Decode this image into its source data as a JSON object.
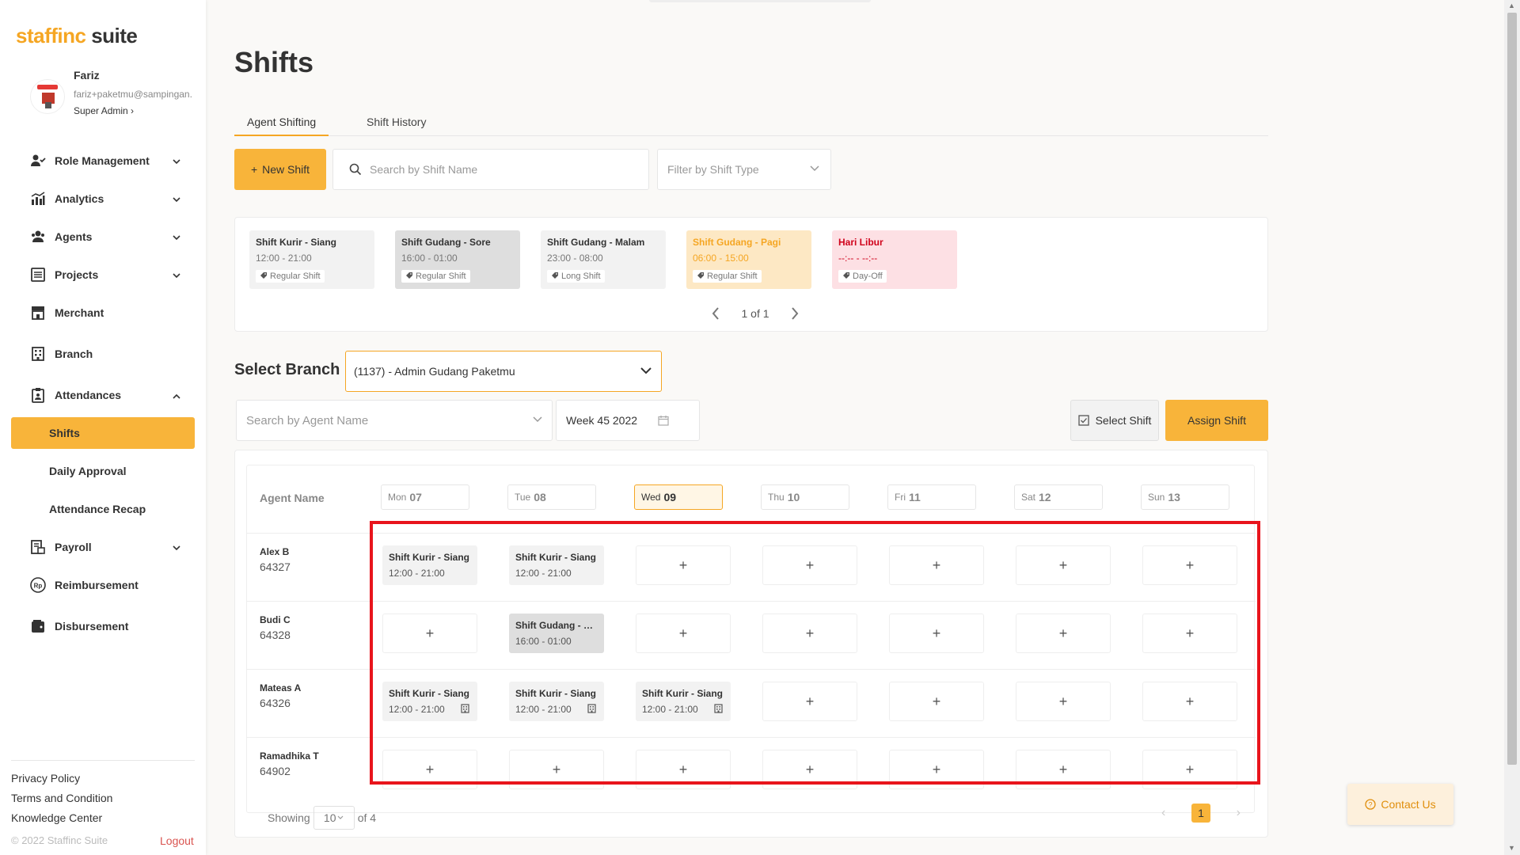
{
  "brand": {
    "name_part1": "staffinc",
    "name_part2": "suite",
    "accent": "#f8b43a",
    "highlight": "#e8141c"
  },
  "profile": {
    "name": "Fariz",
    "email": "fariz+paketmu@sampingan.",
    "role": "Super Admin",
    "avatar_text": "Paketmu"
  },
  "sidebar": {
    "items": [
      {
        "label": "Role Management",
        "icon": "role-icon",
        "expandable": true
      },
      {
        "label": "Analytics",
        "icon": "analytics-icon",
        "expandable": true
      },
      {
        "label": "Agents",
        "icon": "agents-icon",
        "expandable": true
      },
      {
        "label": "Projects",
        "icon": "projects-icon",
        "expandable": true
      },
      {
        "label": "Merchant",
        "icon": "merchant-icon",
        "expandable": false
      },
      {
        "label": "Branch",
        "icon": "branch-icon",
        "expandable": false
      },
      {
        "label": "Attendances",
        "icon": "attendance-icon",
        "expandable": true,
        "expanded": true
      },
      {
        "label": "Payroll",
        "icon": "payroll-icon",
        "expandable": true
      },
      {
        "label": "Reimbursement",
        "icon": "reimbursement-icon",
        "expandable": false
      },
      {
        "label": "Disbursement",
        "icon": "disbursement-icon",
        "expandable": false
      }
    ],
    "sub_items": [
      {
        "label": "Shifts",
        "active": true
      },
      {
        "label": "Daily Approval",
        "active": false
      },
      {
        "label": "Attendance Recap",
        "active": false
      }
    ],
    "footer_links": [
      "Privacy Policy",
      "Terms and Condition",
      "Knowledge Center"
    ],
    "copyright": "© 2022 Staffinc Suite",
    "logout": "Logout"
  },
  "page": {
    "title": "Shifts"
  },
  "tabs": [
    {
      "label": "Agent Shifting",
      "active": true
    },
    {
      "label": "Shift History",
      "active": false
    }
  ],
  "toolbar": {
    "new_shift": "New Shift",
    "search_placeholder": "Search by Shift Name",
    "filter_placeholder": "Filter by Shift Type"
  },
  "shift_types": [
    {
      "name": "Shift Kurir - Siang",
      "time": "12:00 - 21:00",
      "tag": "Regular Shift",
      "bg": "#f2f2f2",
      "name_color": "#333",
      "time_color": "#777"
    },
    {
      "name": "Shift Gudang - Sore",
      "time": "16:00 - 01:00",
      "tag": "Regular Shift",
      "bg": "#dedede",
      "name_color": "#333",
      "time_color": "#777"
    },
    {
      "name": "Shift Gudang - Malam",
      "time": "23:00 - 08:00",
      "tag": "Long Shift",
      "bg": "#f2f2f2",
      "name_color": "#333",
      "time_color": "#777"
    },
    {
      "name": "Shift Gudang - Pagi",
      "time": "06:00 - 15:00",
      "tag": "Regular Shift",
      "bg": "#fde8c4",
      "name_color": "#f5a623",
      "time_color": "#f5a623"
    },
    {
      "name": "Hari Libur",
      "time": "--:-- - --:--",
      "tag": "Day-Off",
      "bg": "#fde0e4",
      "name_color": "#d0021b",
      "time_color": "#d0021b"
    }
  ],
  "shift_pager": {
    "text": "1 of 1"
  },
  "branch": {
    "label": "Select Branch",
    "selected": "(1137) - Admin Gudang Paketmu"
  },
  "schedule_toolbar": {
    "agent_search_placeholder": "Search by Agent Name",
    "week": "Week 45 2022",
    "select_shift": "Select Shift",
    "assign_shift": "Assign Shift"
  },
  "schedule": {
    "agent_header": "Agent Name",
    "days": [
      {
        "dow": "Mon",
        "date": "07",
        "today": false
      },
      {
        "dow": "Tue",
        "date": "08",
        "today": false
      },
      {
        "dow": "Wed",
        "date": "09",
        "today": true
      },
      {
        "dow": "Thu",
        "date": "10",
        "today": false
      },
      {
        "dow": "Fri",
        "date": "11",
        "today": false
      },
      {
        "dow": "Sat",
        "date": "12",
        "today": false
      },
      {
        "dow": "Sun",
        "date": "13",
        "today": false
      }
    ],
    "rows": [
      {
        "name": "Alex B",
        "id": "64327",
        "cells": [
          {
            "name": "Shift Kurir - Siang",
            "time": "12:00 - 21:00",
            "bg": "#f2f2f2",
            "icon": false
          },
          {
            "name": "Shift Kurir - Siang",
            "time": "12:00 - 21:00",
            "bg": "#f2f2f2",
            "icon": false
          },
          null,
          null,
          null,
          null,
          null
        ]
      },
      {
        "name": "Budi C",
        "id": "64328",
        "cells": [
          null,
          {
            "name": "Shift Gudang - So...",
            "time": "16:00 - 01:00",
            "bg": "#dedede",
            "icon": false
          },
          null,
          null,
          null,
          null,
          null
        ]
      },
      {
        "name": "Mateas A",
        "id": "64326",
        "cells": [
          {
            "name": "Shift Kurir - Siang",
            "time": "12:00 - 21:00",
            "bg": "#f2f2f2",
            "icon": true
          },
          {
            "name": "Shift Kurir - Siang",
            "time": "12:00 - 21:00",
            "bg": "#f2f2f2",
            "icon": true
          },
          {
            "name": "Shift Kurir - Siang",
            "time": "12:00 - 21:00",
            "bg": "#f2f2f2",
            "icon": true
          },
          null,
          null,
          null,
          null
        ]
      },
      {
        "name": "Ramadhika T",
        "id": "64902",
        "cells": [
          null,
          null,
          null,
          null,
          null,
          null,
          null
        ]
      }
    ],
    "add_symbol": "+"
  },
  "table_footer": {
    "showing": "Showing",
    "per_page": "10",
    "of_total": "of 4",
    "current_page": "1"
  },
  "contact": {
    "label": "Contact Us"
  }
}
